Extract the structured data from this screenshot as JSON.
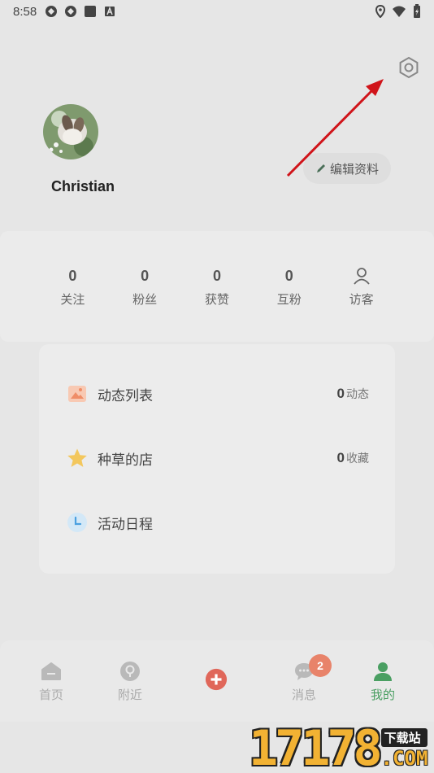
{
  "status_bar": {
    "time": "8:58"
  },
  "profile": {
    "username": "Christian",
    "edit_label": "编辑资料"
  },
  "stats": [
    {
      "value": "0",
      "label": "关注"
    },
    {
      "value": "0",
      "label": "粉丝"
    },
    {
      "value": "0",
      "label": "获赞"
    },
    {
      "value": "0",
      "label": "互粉"
    },
    {
      "value": "",
      "label": "访客",
      "icon": "person-icon"
    }
  ],
  "menu": [
    {
      "label": "动态列表",
      "count": "0",
      "unit": "动态",
      "icon": "image-icon"
    },
    {
      "label": "种草的店",
      "count": "0",
      "unit": "收藏",
      "icon": "star-icon"
    },
    {
      "label": "活动日程",
      "icon": "clock-icon"
    }
  ],
  "tabs": [
    {
      "label": "首页",
      "icon": "home-icon"
    },
    {
      "label": "附近",
      "icon": "location-icon"
    },
    {
      "label": "",
      "icon": "plus-icon"
    },
    {
      "label": "消息",
      "icon": "chat-icon",
      "badge": "2"
    },
    {
      "label": "我的",
      "icon": "profile-icon",
      "active": true
    }
  ],
  "colors": {
    "accent_green": "#4a9f62",
    "badge": "#e8836a",
    "plus": "#e0675a",
    "arrow": "#d0141a"
  },
  "watermark": {
    "digits": "17178",
    "cn": "下载站",
    "com": ".COM"
  }
}
